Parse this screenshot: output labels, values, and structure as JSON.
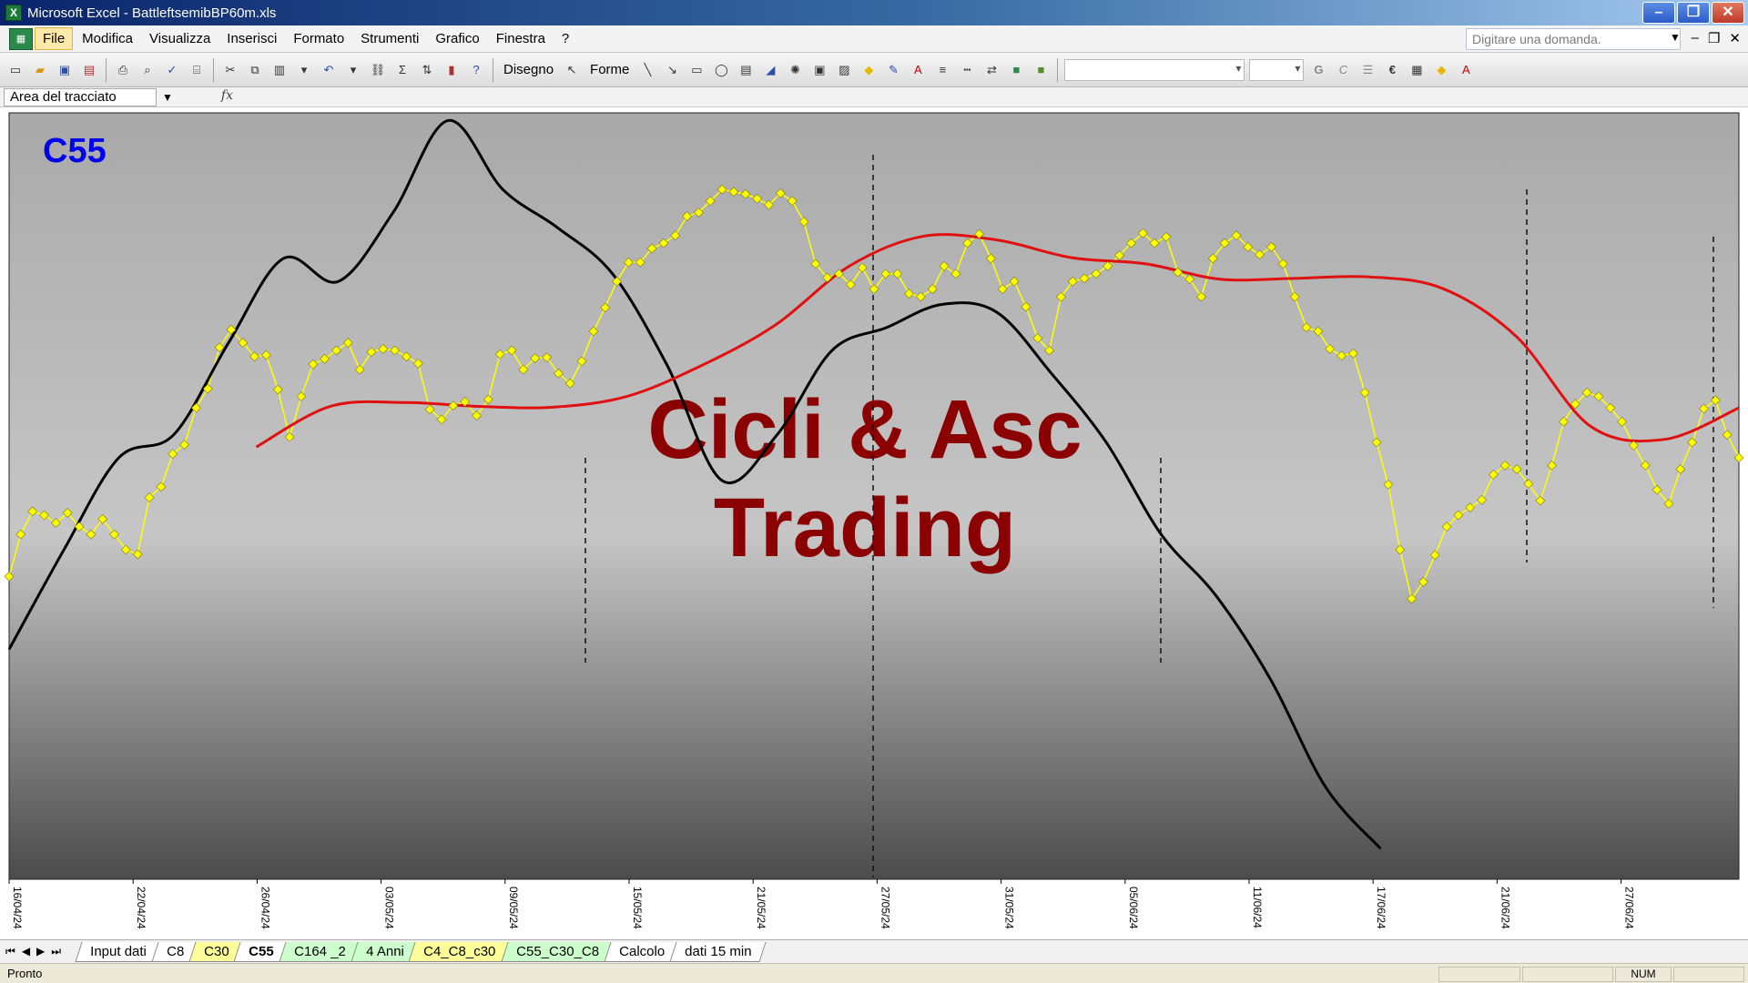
{
  "window": {
    "title": "Microsoft Excel - BattleftsemibBP60m.xls"
  },
  "menu": {
    "items": [
      {
        "label": "File",
        "active": true
      },
      {
        "label": "Modifica"
      },
      {
        "label": "Visualizza"
      },
      {
        "label": "Inserisci"
      },
      {
        "label": "Formato"
      },
      {
        "label": "Strumenti"
      },
      {
        "label": "Grafico"
      },
      {
        "label": "Finestra"
      },
      {
        "label": "?"
      }
    ],
    "help_placeholder": "Digitare una domanda."
  },
  "toolbar": {
    "draw_label": "Disegno",
    "shapes_label": "Forme",
    "bold_glyph": "G",
    "italic_glyph": "C",
    "euro_glyph": "€"
  },
  "formula_bar": {
    "name_box": "Area del tracciato",
    "fx": "fx"
  },
  "chart_data": {
    "type": "line",
    "title": "C55",
    "watermark": [
      "Cicli & Asc",
      "Trading"
    ],
    "x_ticks": [
      "16/04/24",
      "22/04/24",
      "26/04/24",
      "03/05/24",
      "09/05/24",
      "15/05/24",
      "21/05/24",
      "27/05/24",
      "31/05/24",
      "05/06/24",
      "11/06/24",
      "17/06/24",
      "21/06/24",
      "27/06/24"
    ],
    "x": [
      0,
      1,
      2,
      3,
      4,
      5,
      6,
      7,
      8,
      9,
      10,
      11,
      12,
      13,
      14,
      15,
      16,
      17,
      18,
      19,
      20,
      21,
      22,
      23,
      24,
      25,
      26,
      27,
      28,
      29,
      30,
      31,
      32,
      33,
      34,
      35,
      36,
      37,
      38,
      39,
      40,
      41,
      42,
      43,
      44,
      45,
      46,
      47,
      48,
      49,
      50,
      51,
      52,
      53,
      54,
      55,
      56,
      57,
      58,
      59,
      60,
      61,
      62,
      63,
      64,
      65,
      66,
      67,
      68,
      69,
      70,
      71,
      72,
      73,
      74,
      75,
      76,
      77,
      78,
      79,
      80,
      81,
      82,
      83,
      84,
      85,
      86,
      87,
      88,
      89,
      90,
      91,
      92,
      93,
      94,
      95,
      96,
      97,
      98,
      99,
      100,
      101,
      102,
      103,
      104,
      105,
      106,
      107,
      108,
      109,
      110,
      111,
      112,
      113,
      114,
      115,
      116,
      117,
      118,
      119,
      120,
      121,
      122,
      123,
      124,
      125,
      126,
      127,
      128,
      129,
      130,
      131,
      132,
      133,
      134,
      135,
      136,
      137,
      138,
      139,
      140
    ],
    "y_range": [
      0,
      100
    ],
    "series": [
      {
        "color": "#ffff00",
        "marker": "diamond",
        "values": [
          39.5,
          45,
          48,
          47.5,
          46.5,
          47.8,
          46,
          45,
          47,
          45,
          43,
          42.4,
          49.8,
          51.2,
          55.5,
          56.7,
          61.5,
          64,
          69.4,
          71.7,
          70,
          68.2,
          68.4,
          63.9,
          57.7,
          63,
          67.2,
          67.9,
          69,
          70,
          66.5,
          68.8,
          69.2,
          69,
          68.2,
          67.3,
          61.3,
          60,
          61.8,
          62.3,
          60.5,
          62.6,
          68.5,
          69,
          66.5,
          68,
          68.1,
          66,
          64.7,
          67.6,
          71.5,
          74.6,
          78,
          80.5,
          80.5,
          82.3,
          83,
          84,
          86.5,
          87,
          88.5,
          90,
          89.7,
          89.4,
          88.8,
          88,
          89.5,
          88.5,
          85.8,
          80.3,
          78.5,
          79,
          77.6,
          79.8,
          77,
          79,
          79,
          76.4,
          76,
          77,
          80,
          79,
          83,
          84.2,
          81,
          77,
          78,
          74.7,
          70.6,
          69,
          76,
          78,
          78.4,
          79,
          80,
          81.4,
          83,
          84.3,
          83,
          83.8,
          79.2,
          78.3,
          76,
          81,
          83,
          84,
          82.5,
          81.5,
          82.5,
          80.3,
          76,
          72,
          71.5,
          69.2,
          68.3,
          68.6,
          63.5,
          57,
          51.5,
          43,
          36.6,
          38.8,
          42.3,
          46,
          47.5,
          48.5,
          49.5,
          52.8,
          54,
          53.5,
          51.6,
          49.4,
          54,
          59.7,
          62,
          63.5,
          63,
          61.5,
          59.7,
          56.6,
          54,
          50.8,
          49,
          53.5,
          57,
          61.4,
          62.5,
          58,
          55
        ]
      },
      {
        "color": "#000000",
        "marker": "none",
        "values": [
          30,
          43,
          55,
          58,
          70,
          81,
          78,
          87,
          99,
          90,
          85,
          79,
          67,
          52,
          58,
          69,
          72,
          75,
          74,
          66,
          57,
          45,
          37,
          26,
          12,
          4
        ]
      },
      {
        "color": "#e01010",
        "marker": "none",
        "values": [
          56.4,
          61.7,
          62.2,
          61.7,
          61.6,
          63,
          67,
          72.3,
          80,
          83.9,
          83.4,
          81.1,
          80.3,
          78.3,
          78.4,
          78.6,
          77.1,
          70.8,
          59.1,
          57.4,
          61.5
        ]
      }
    ],
    "vertical_dashed_markers": 4,
    "grid": false,
    "legend": "none"
  },
  "sheet_tabs": [
    {
      "label": "Input dati",
      "color": "#ffffff"
    },
    {
      "label": "C8",
      "color": "#ffffff"
    },
    {
      "label": "C30",
      "color": "#ffff99"
    },
    {
      "label": "C55",
      "color": "#ffffff",
      "active": true
    },
    {
      "label": "C164 _2",
      "color": "#ccffcc"
    },
    {
      "label": "4 Anni",
      "color": "#ccffcc"
    },
    {
      "label": "C4_C8_c30",
      "color": "#ffff99"
    },
    {
      "label": "C55_C30_C8",
      "color": "#ccffcc"
    },
    {
      "label": "Calcolo",
      "color": "#ffffff"
    },
    {
      "label": "dati 15 min",
      "color": "#ffffff"
    }
  ],
  "status": {
    "ready": "Pronto",
    "num": "NUM"
  }
}
